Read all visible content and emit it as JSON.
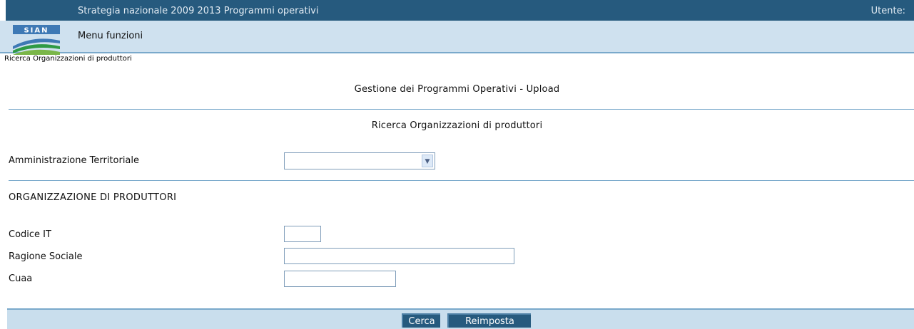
{
  "header": {
    "title": "Strategia nazionale 2009 2013 Programmi operativi",
    "user_label": "Utente:"
  },
  "menu": {
    "label": "Menu funzioni"
  },
  "logo": {
    "text": "SIAN"
  },
  "breadcrumb": "Ricerca Organizzazioni di produttori",
  "page_title": "Gestione dei Programmi Operativi - Upload",
  "section_title": "Ricerca Organizzazioni di produttori",
  "filters": {
    "amministrazione_label": "Amministrazione Territoriale",
    "amministrazione_value": ""
  },
  "organizzazione": {
    "heading": "ORGANIZZAZIONE DI PRODUTTORI",
    "codice_label": "Codice IT",
    "codice_value": "",
    "ragione_label": "Ragione Sociale",
    "ragione_value": "",
    "cuaa_label": "Cuaa",
    "cuaa_value": ""
  },
  "buttons": {
    "search": "Cerca",
    "reset": "Reimposta"
  },
  "colors": {
    "header_bg": "#265a7e",
    "menu_bg": "#cfe1ef",
    "rule": "#7aa9cb"
  }
}
